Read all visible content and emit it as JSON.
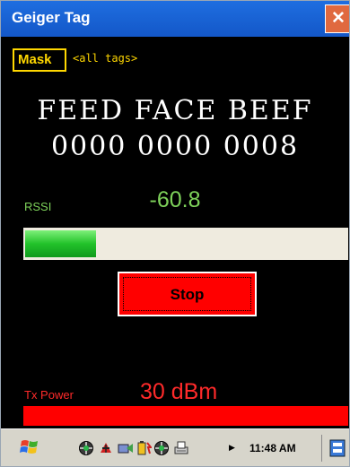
{
  "window": {
    "title": "Geiger Tag",
    "close_glyph": "✕"
  },
  "mask": {
    "label": "Mask",
    "value": "<all tags>"
  },
  "epc": {
    "line1": "FEED FACE BEEF",
    "line2": "0000 0000 0008"
  },
  "rssi": {
    "label": "RSSI",
    "value": "-60.8",
    "level_percent": 22
  },
  "stop_button": {
    "label": "Stop"
  },
  "tx_power": {
    "label": "Tx Power",
    "value": "30 dBm",
    "level_percent": 100
  },
  "taskbar": {
    "start_icon": "windows-flag-icon",
    "tray_icons": [
      "network-icon",
      "bluetooth-icon",
      "connection-icon",
      "battery-icon",
      "sync-icon",
      "printer-icon"
    ],
    "clock": "11:48 AM"
  },
  "colors": {
    "titlebar": "#1357c8",
    "accent_yellow": "#ffd700",
    "rssi_green": "#7ed25a",
    "stop_red": "#ff0000",
    "tx_red": "#ff2a2a"
  }
}
